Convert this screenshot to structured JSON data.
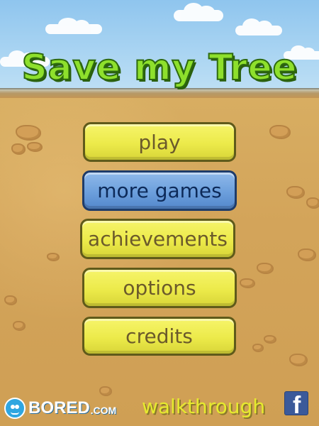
{
  "game": {
    "title": "Save my Tree"
  },
  "menu": {
    "play_label": "play",
    "more_games_label": "more games",
    "achievements_label": "achievements",
    "options_label": "options",
    "credits_label": "credits"
  },
  "footer": {
    "brand_name": "BORED",
    "brand_suffix": ".COM",
    "walkthrough_label": "walkthrough",
    "facebook_letter": "f"
  },
  "colors": {
    "sky": "#a9d4f2",
    "ground": "#d3a45a",
    "title_green": "#8ee02c",
    "button_yellow": "#ecea4a",
    "button_blue": "#6c9fdc",
    "facebook_blue": "#3b5a9a"
  },
  "icons": [
    "bored-face-icon",
    "facebook-icon"
  ]
}
